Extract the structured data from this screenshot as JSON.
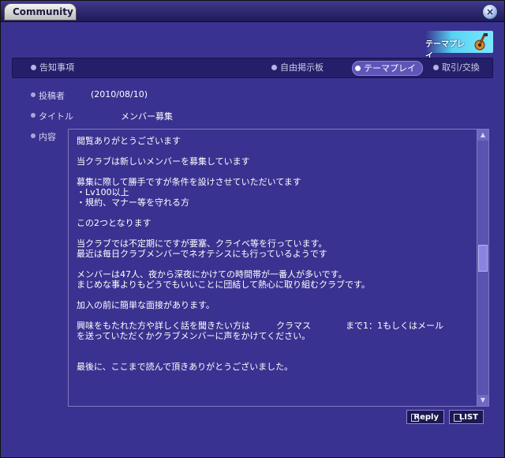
{
  "window": {
    "title": "Community",
    "close_label": "×"
  },
  "banner": {
    "label": "テーマプレイ",
    "icon": "guitar-icon"
  },
  "tabs": [
    {
      "label": "告知事項",
      "active": false
    },
    {
      "label": "自由掲示板",
      "active": false
    },
    {
      "label": "テーマプレイ",
      "active": true
    },
    {
      "label": "取引/交換",
      "active": false
    }
  ],
  "post": {
    "poster_label": "投稿者",
    "poster_value": "(2010/08/10)",
    "title_label": "タイトル",
    "title_value": "メンバー募集",
    "content_label": "内容",
    "content_text": "閲覧ありがとうございます\n\n当クラブは新しいメンバーを募集しています\n\n募集に際して勝手ですが条件を設けさせていただいてます\n・Lv100以上\n・規約、マナー等を守れる方\n\nこの2つとなります\n\n当クラブでは不定期にですが要塞、クライベ等を行っています。\n最近は毎日クラブメンバーでネオテシスにも行っているようです\n\nメンバーは47人、夜から深夜にかけての時間帯が一番人が多いです。\nまじめな事よりもどうでもいいことに団結して熱心に取り組むクラブです。\n\n加入の前に簡単な面接があります。\n\n興味をもたれた方や詳しく話を聞きたい方は　　　クラマス　　　　まで1：1もしくはメール\nを送っていただくかクラブメンバーに声をかけてください。\n\n\n最後に、ここまで読んで頂きありがとうございました。"
  },
  "scroll": {
    "up": "▲",
    "down": "▼"
  },
  "buttons": {
    "reply": "Reply",
    "list": "LIST"
  }
}
